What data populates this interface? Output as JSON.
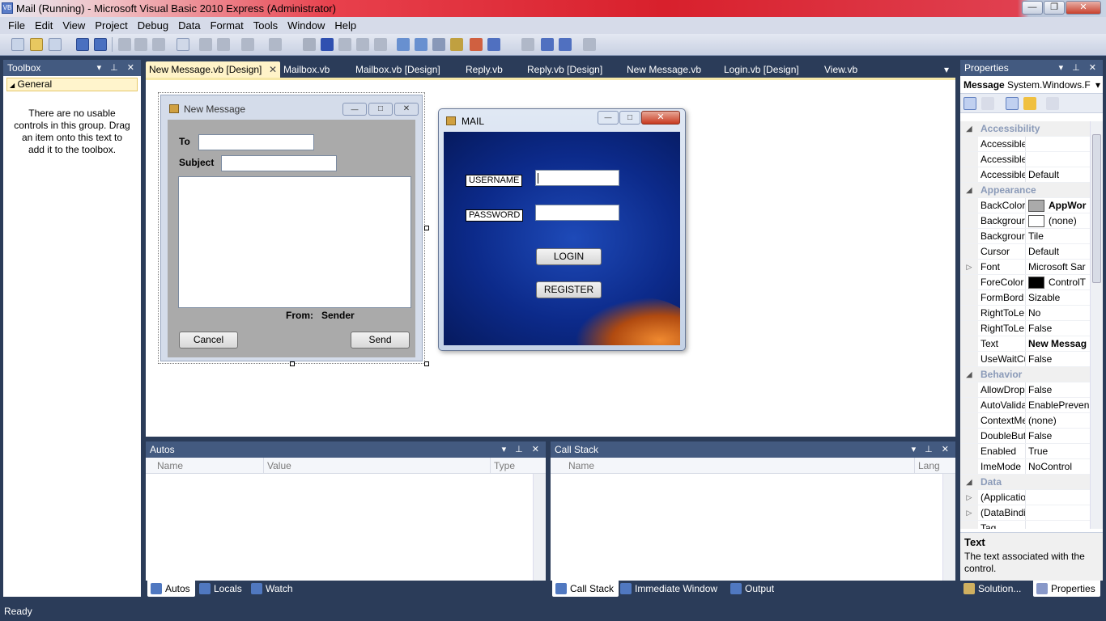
{
  "window": {
    "title": "Mail (Running) - Microsoft Visual Basic 2010 Express (Administrator)",
    "icon_text": "VB",
    "minimize": "—",
    "restore": "❐",
    "close": "✕"
  },
  "menu": [
    {
      "label": "File"
    },
    {
      "label": "Edit"
    },
    {
      "label": "View"
    },
    {
      "label": "Project"
    },
    {
      "label": "Debug"
    },
    {
      "label": "Data"
    },
    {
      "label": "Format"
    },
    {
      "label": "Tools"
    },
    {
      "label": "Window"
    },
    {
      "label": "Help"
    }
  ],
  "toolbox": {
    "title": "Toolbox",
    "group": "General",
    "group_arrow": "◢",
    "empty_message": "There are no usable controls in this group. Drag an item onto this text to add it to the toolbox.",
    "head_icons": "▾ ⊥ ✕"
  },
  "doc_tabs": [
    {
      "label": "New Message.vb [Design]",
      "active": true
    },
    {
      "label": "Mailbox.vb"
    },
    {
      "label": "Mailbox.vb [Design]"
    },
    {
      "label": "Reply.vb"
    },
    {
      "label": "Reply.vb [Design]"
    },
    {
      "label": "New Message.vb"
    },
    {
      "label": "Login.vb [Design]"
    },
    {
      "label": "View.vb"
    }
  ],
  "doc_tab_close": "✕",
  "doc_tab_menu": "▾",
  "new_message_form": {
    "title": "New Message",
    "to_label": "To",
    "subject_label": "Subject",
    "from_label": "From:",
    "sender_label": "Sender",
    "cancel": "Cancel",
    "send": "Send",
    "min": "—",
    "max": "□",
    "close": "✕"
  },
  "mail_window": {
    "title": "MAIL",
    "username_label": "USERNAME",
    "password_label": "PASSWORD",
    "login": "LOGIN",
    "register": "REGISTER",
    "min": "—",
    "max": "□",
    "close": "✕"
  },
  "properties": {
    "title": "Properties",
    "head_icons": "▾ ⊥ ✕",
    "object_name": "Message",
    "object_type": "System.Windows.F",
    "object_arrow": "▾",
    "rows": [
      {
        "cat": true,
        "name": "Accessibility"
      },
      {
        "name": "Accessible",
        "value": ""
      },
      {
        "name": "Accessible",
        "value": ""
      },
      {
        "name": "Accessible",
        "value": "Default"
      },
      {
        "cat": true,
        "name": "Appearance"
      },
      {
        "name": "BackColor",
        "value": "AppWor",
        "swatch": "#aaaaaa",
        "bold": true
      },
      {
        "name": "Backgrour",
        "value": "(none)",
        "swatch": "#ffffff"
      },
      {
        "name": "Backgrour",
        "value": "Tile"
      },
      {
        "name": "Cursor",
        "value": "Default"
      },
      {
        "name": "Font",
        "value": "Microsoft Sar",
        "expand": true
      },
      {
        "name": "ForeColor",
        "value": "ControlT",
        "swatch": "#000000"
      },
      {
        "name": "FormBord",
        "value": "Sizable"
      },
      {
        "name": "RightToLe",
        "value": "No"
      },
      {
        "name": "RightToLe",
        "value": "False"
      },
      {
        "name": "Text",
        "value": "New Messag",
        "bold": true
      },
      {
        "name": "UseWaitCu",
        "value": "False"
      },
      {
        "cat": true,
        "name": "Behavior"
      },
      {
        "name": "AllowDrop",
        "value": "False"
      },
      {
        "name": "AutoValida",
        "value": "EnablePreven"
      },
      {
        "name": "ContextMe",
        "value": "(none)"
      },
      {
        "name": "DoubleBut",
        "value": "False"
      },
      {
        "name": "Enabled",
        "value": "True"
      },
      {
        "name": "ImeMode",
        "value": "NoControl"
      },
      {
        "cat": true,
        "name": "Data"
      },
      {
        "name": "(Applicatio",
        "value": "",
        "expand": true
      },
      {
        "name": "(DataBindi",
        "value": "",
        "expand": true
      },
      {
        "name": "Tag",
        "value": ""
      }
    ],
    "desc_title": "Text",
    "desc_text": "The text associated with the control.",
    "bottom_tabs": [
      {
        "label": "Solution..."
      },
      {
        "label": "Properties",
        "active": true
      }
    ]
  },
  "autos": {
    "title": "Autos",
    "head_icons": "▾ ⊥ ✕",
    "columns": [
      "Name",
      "Value",
      "Type"
    ]
  },
  "callstack": {
    "title": "Call Stack",
    "head_icons": "▾ ⊥ ✕",
    "columns": [
      "Name",
      "Lang"
    ]
  },
  "bottom_tabs_left": [
    {
      "label": "Autos",
      "active": true
    },
    {
      "label": "Locals"
    },
    {
      "label": "Watch"
    }
  ],
  "bottom_tabs_right": [
    {
      "label": "Call Stack",
      "active": true
    },
    {
      "label": "Immediate Window"
    },
    {
      "label": "Output"
    }
  ],
  "status": "Ready",
  "colors": {
    "chrome": "#2b3c59",
    "panel_head": "#435a80",
    "active_tab": "#fff3c8",
    "mail_bg": "#0c2a8a"
  }
}
